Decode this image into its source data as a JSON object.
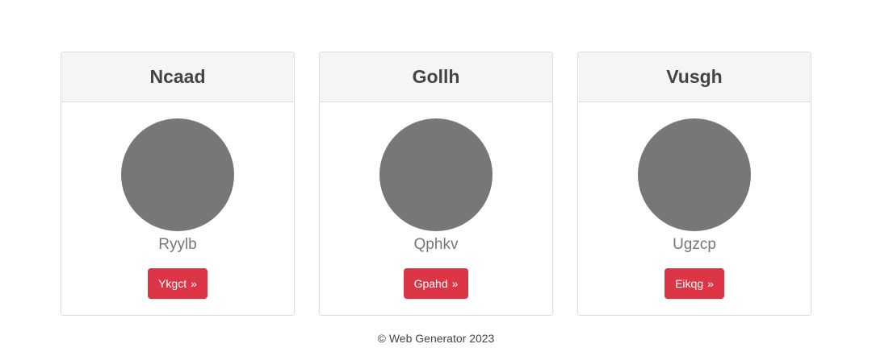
{
  "cards": [
    {
      "title": "Ncaad",
      "name": "Ryylb",
      "button_label": "Ykgct",
      "button_icon": "»"
    },
    {
      "title": "Gollh",
      "name": "Qphkv",
      "button_label": "Gpahd",
      "button_icon": "»"
    },
    {
      "title": "Vusgh",
      "name": "Ugzcp",
      "button_label": "Eikqg",
      "button_icon": "»"
    }
  ],
  "footer": {
    "text": "© Web Generator 2023"
  },
  "colors": {
    "button_bg": "#dc3545",
    "avatar_bg": "#777777",
    "header_bg": "#f5f5f5"
  }
}
